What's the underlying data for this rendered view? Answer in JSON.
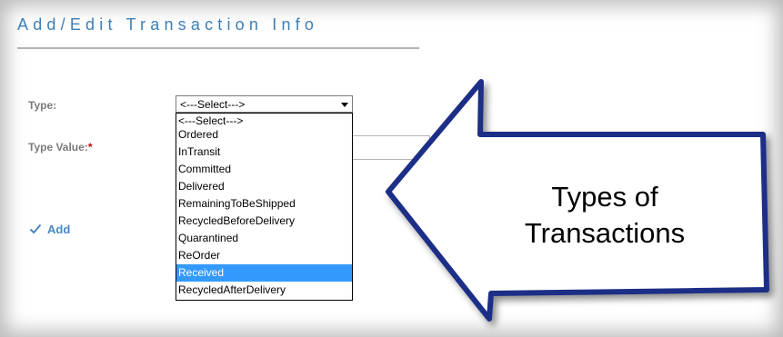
{
  "form": {
    "title": "Add/Edit Transaction Info",
    "type_label": "Type:",
    "type_value_label": "Type Value:",
    "required_marker": "*",
    "selected_value": "<---Select--->",
    "add_label": "Add"
  },
  "dropdown": {
    "options": [
      "<---Select--->",
      "Ordered",
      "InTransit",
      "Committed",
      "Delivered",
      "RemainingToBeShipped",
      "RecycledBeforeDelivery",
      "Quarantined",
      "ReOrder",
      "Received",
      "RecycledAfterDelivery"
    ],
    "highlighted": "Received"
  },
  "callout": {
    "line1": "Types of",
    "line2": "Transactions"
  },
  "colors": {
    "title": "#3c7fb8",
    "highlight": "#3399ff",
    "arrow_fill": "#ffffff",
    "arrow_border": "#1f2f86",
    "required": "#cc0000"
  },
  "icons": {
    "add": "checkmark-icon",
    "select": "chevron-down-icon"
  }
}
